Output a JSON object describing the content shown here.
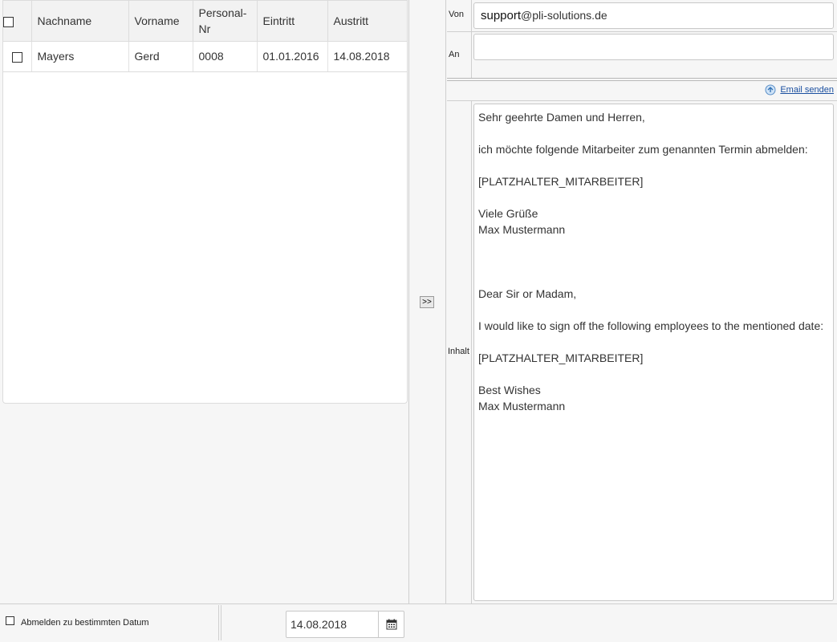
{
  "table": {
    "columns": [
      "Nachname",
      "Vorname",
      "Personal-\nNr",
      "Eintritt",
      "Austritt"
    ],
    "rows": [
      {
        "nachname": "Mayers",
        "vorname": "Gerd",
        "personal_nr": "0008",
        "eintritt": "01.01.2016",
        "austritt": "14.08.2018"
      }
    ]
  },
  "transfer_button": ">>",
  "email": {
    "von_label": "Von",
    "von_user": "support",
    "von_domain": "@pli-solutions.de",
    "an_label": "An",
    "an_value": "",
    "send_label": "Email senden",
    "inhalt_label": "Inhalt",
    "content": "Sehr geehrte Damen und Herren,\n\nich möchte folgende Mitarbeiter zum genannten Termin abmelden:\n\n[PLATZHALTER_MITARBEITER]\n\nViele Grüße\nMax Mustermann\n\n\n\nDear Sir or Madam,\n\nI would like to sign off the following employees to the mentioned date:\n\n[PLATZHALTER_MITARBEITER]\n\nBest Wishes\nMax Mustermann"
  },
  "footer": {
    "abmelden_label": "Abmelden zu bestimmten Datum",
    "date_value": "14.08.2018"
  },
  "icons": {
    "send": "email-send-icon",
    "calendar": "calendar-icon"
  }
}
